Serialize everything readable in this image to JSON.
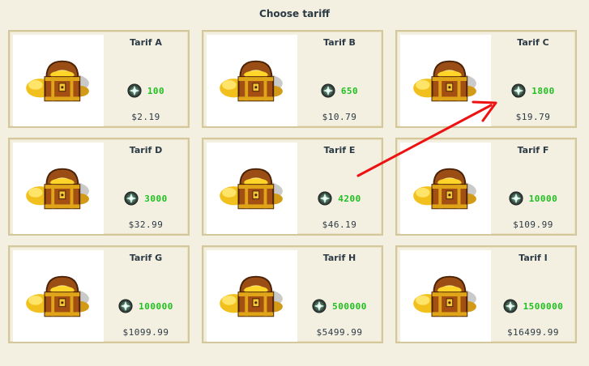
{
  "page": {
    "title": "Choose tariff"
  },
  "tariffs": [
    {
      "name": "Tarif A",
      "amount": "100",
      "price": "$2.19"
    },
    {
      "name": "Tarif B",
      "amount": "650",
      "price": "$10.79"
    },
    {
      "name": "Tarif C",
      "amount": "1800",
      "price": "$19.79"
    },
    {
      "name": "Tarif D",
      "amount": "3000",
      "price": "$32.99"
    },
    {
      "name": "Tarif E",
      "amount": "4200",
      "price": "$46.19"
    },
    {
      "name": "Tarif F",
      "amount": "10000",
      "price": "$109.99"
    },
    {
      "name": "Tarif G",
      "amount": "100000",
      "price": "$1099.99"
    },
    {
      "name": "Tarif H",
      "amount": "500000",
      "price": "$5499.99"
    },
    {
      "name": "Tarif I",
      "amount": "1500000",
      "price": "$16499.99"
    }
  ],
  "icons": {
    "chest": "treasure-chest-icon",
    "currency": "gem-icon",
    "annotation": "red-arrow-icon"
  },
  "colors": {
    "amount": "#1fc01f",
    "border": "#d3c79b",
    "background": "#f3efe1",
    "arrow": "#ee1111"
  }
}
